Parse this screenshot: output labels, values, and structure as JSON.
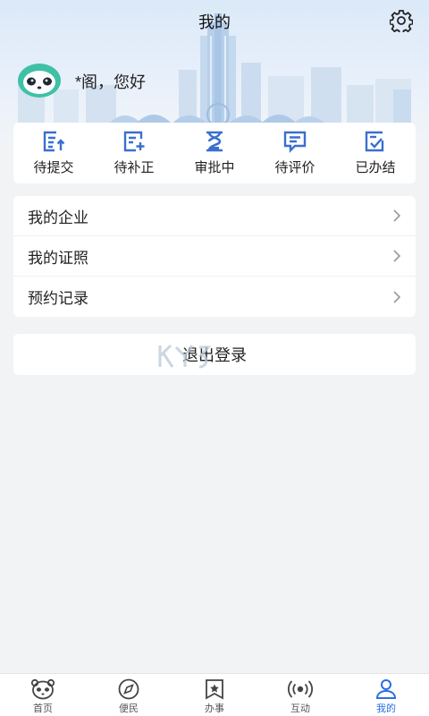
{
  "header": {
    "title": "我的"
  },
  "user": {
    "greeting": "*阁，您好"
  },
  "status": [
    {
      "label": "待提交",
      "icon": "submit-doc-icon"
    },
    {
      "label": "待补正",
      "icon": "supplement-doc-icon"
    },
    {
      "label": "审批中",
      "icon": "hourglass-icon"
    },
    {
      "label": "待评价",
      "icon": "comment-icon"
    },
    {
      "label": "已办结",
      "icon": "done-doc-icon"
    }
  ],
  "menu": [
    {
      "label": "我的企业"
    },
    {
      "label": "我的证照"
    },
    {
      "label": "预约记录"
    }
  ],
  "logout": {
    "label": "退出登录"
  },
  "tabs": [
    {
      "label": "首页",
      "icon": "panda-home-icon"
    },
    {
      "label": "便民",
      "icon": "compass-icon"
    },
    {
      "label": "办事",
      "icon": "bookmark-star-icon"
    },
    {
      "label": "互动",
      "icon": "broadcast-icon"
    },
    {
      "label": "我的",
      "icon": "person-icon",
      "active": true
    }
  ],
  "colors": {
    "accent": "#2a6fe3",
    "icon": "#3a6fcf",
    "background": "#f2f3f5"
  }
}
